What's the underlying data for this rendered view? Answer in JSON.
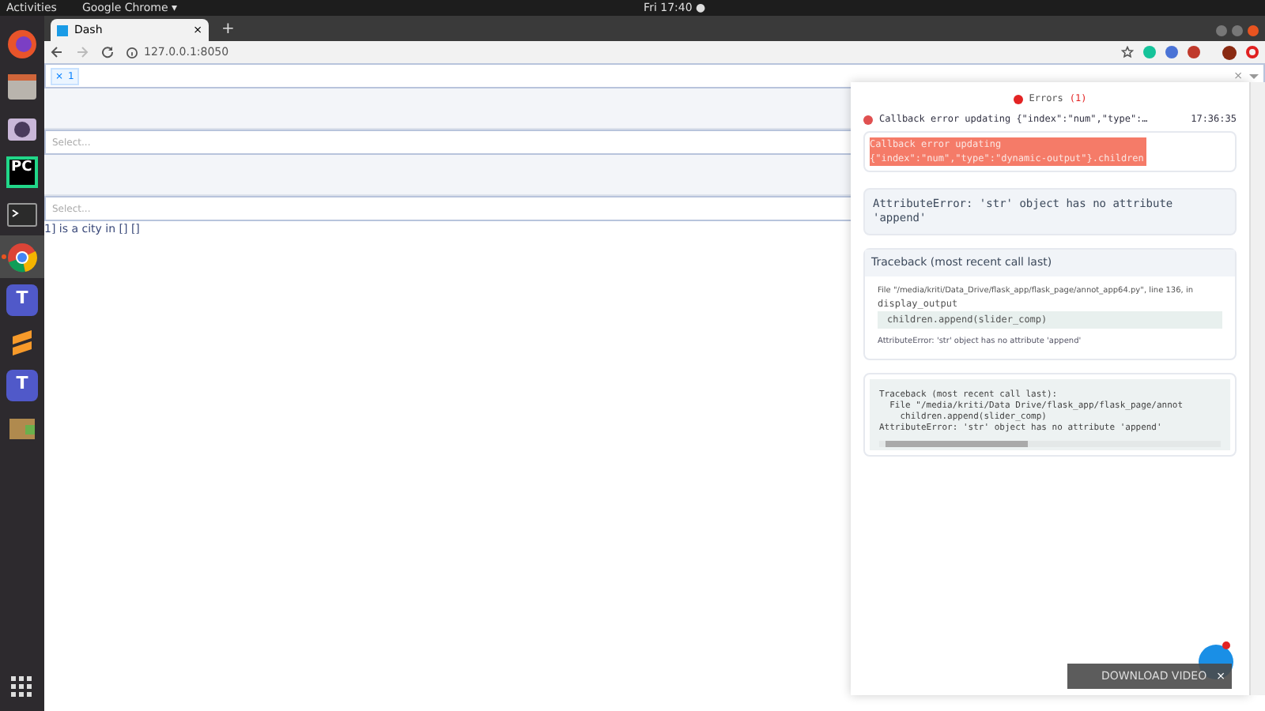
{
  "topbar": {
    "activities": "Activities",
    "app": "Google Chrome ▾",
    "clock": "Fri 17:40 ●"
  },
  "dock": [
    {
      "kind": "firefox"
    },
    {
      "kind": "files"
    },
    {
      "kind": "camera"
    },
    {
      "kind": "pycharm",
      "label": "PC"
    },
    {
      "kind": "terminal"
    },
    {
      "kind": "chrome",
      "selected": true
    },
    {
      "kind": "teams",
      "label": "T"
    },
    {
      "kind": "sublime"
    },
    {
      "kind": "teams",
      "label": "T"
    },
    {
      "kind": "archive"
    }
  ],
  "browser": {
    "tab": {
      "title": "Dash",
      "close": "×"
    },
    "new_tab": "+",
    "url": "127.0.0.1:8050"
  },
  "page": {
    "multi_select": {
      "tags": [
        {
          "remove": "×",
          "label": "1"
        }
      ],
      "clear": "×"
    },
    "dropdowns": [
      {
        "placeholder": "Select..."
      },
      {
        "placeholder": "Select..."
      }
    ],
    "output": "1] is a city in [] []"
  },
  "errors": {
    "title": "Errors",
    "count": "(1)",
    "header": "Callback error updating {\"index\":\"num\",\"type\":…",
    "time": "17:36:35",
    "message": "Callback error updating {\"index\":\"num\",\"type\":\"dynamic-output\"}.children",
    "exception": "AttributeError: 'str' object has no attribute 'append'",
    "traceback_title": "Traceback (most recent call last)",
    "frame_file": "File \"/media/kriti/Data_Drive/flask_app/flask_page/annot_app64.py\", line 136, in",
    "frame_func": "display_output",
    "frame_code": "children.append(slider_comp)",
    "frame_error": "AttributeError: 'str' object has no attribute 'append'",
    "raw_lines": [
      "Traceback (most recent call last):",
      "  File \"/media/kriti/Data Drive/flask_app/flask_page/annot",
      "    children.append(slider_comp)",
      "AttributeError: 'str' object has no attribute 'append'"
    ]
  },
  "download_video": {
    "label": "DOWNLOAD VIDEO",
    "close": "×"
  }
}
